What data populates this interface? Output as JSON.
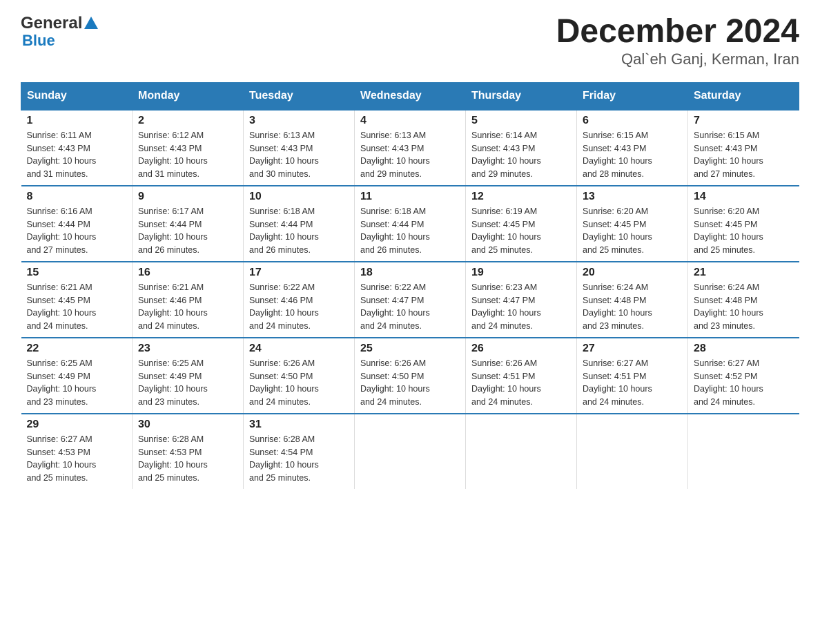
{
  "header": {
    "logo_general": "General",
    "logo_blue": "Blue",
    "title": "December 2024",
    "subtitle": "Qal`eh Ganj, Kerman, Iran"
  },
  "days_of_week": [
    "Sunday",
    "Monday",
    "Tuesday",
    "Wednesday",
    "Thursday",
    "Friday",
    "Saturday"
  ],
  "weeks": [
    [
      {
        "num": "1",
        "sunrise": "6:11 AM",
        "sunset": "4:43 PM",
        "daylight": "10 hours and 31 minutes."
      },
      {
        "num": "2",
        "sunrise": "6:12 AM",
        "sunset": "4:43 PM",
        "daylight": "10 hours and 31 minutes."
      },
      {
        "num": "3",
        "sunrise": "6:13 AM",
        "sunset": "4:43 PM",
        "daylight": "10 hours and 30 minutes."
      },
      {
        "num": "4",
        "sunrise": "6:13 AM",
        "sunset": "4:43 PM",
        "daylight": "10 hours and 29 minutes."
      },
      {
        "num": "5",
        "sunrise": "6:14 AM",
        "sunset": "4:43 PM",
        "daylight": "10 hours and 29 minutes."
      },
      {
        "num": "6",
        "sunrise": "6:15 AM",
        "sunset": "4:43 PM",
        "daylight": "10 hours and 28 minutes."
      },
      {
        "num": "7",
        "sunrise": "6:15 AM",
        "sunset": "4:43 PM",
        "daylight": "10 hours and 27 minutes."
      }
    ],
    [
      {
        "num": "8",
        "sunrise": "6:16 AM",
        "sunset": "4:44 PM",
        "daylight": "10 hours and 27 minutes."
      },
      {
        "num": "9",
        "sunrise": "6:17 AM",
        "sunset": "4:44 PM",
        "daylight": "10 hours and 26 minutes."
      },
      {
        "num": "10",
        "sunrise": "6:18 AM",
        "sunset": "4:44 PM",
        "daylight": "10 hours and 26 minutes."
      },
      {
        "num": "11",
        "sunrise": "6:18 AM",
        "sunset": "4:44 PM",
        "daylight": "10 hours and 26 minutes."
      },
      {
        "num": "12",
        "sunrise": "6:19 AM",
        "sunset": "4:45 PM",
        "daylight": "10 hours and 25 minutes."
      },
      {
        "num": "13",
        "sunrise": "6:20 AM",
        "sunset": "4:45 PM",
        "daylight": "10 hours and 25 minutes."
      },
      {
        "num": "14",
        "sunrise": "6:20 AM",
        "sunset": "4:45 PM",
        "daylight": "10 hours and 25 minutes."
      }
    ],
    [
      {
        "num": "15",
        "sunrise": "6:21 AM",
        "sunset": "4:45 PM",
        "daylight": "10 hours and 24 minutes."
      },
      {
        "num": "16",
        "sunrise": "6:21 AM",
        "sunset": "4:46 PM",
        "daylight": "10 hours and 24 minutes."
      },
      {
        "num": "17",
        "sunrise": "6:22 AM",
        "sunset": "4:46 PM",
        "daylight": "10 hours and 24 minutes."
      },
      {
        "num": "18",
        "sunrise": "6:22 AM",
        "sunset": "4:47 PM",
        "daylight": "10 hours and 24 minutes."
      },
      {
        "num": "19",
        "sunrise": "6:23 AM",
        "sunset": "4:47 PM",
        "daylight": "10 hours and 24 minutes."
      },
      {
        "num": "20",
        "sunrise": "6:24 AM",
        "sunset": "4:48 PM",
        "daylight": "10 hours and 23 minutes."
      },
      {
        "num": "21",
        "sunrise": "6:24 AM",
        "sunset": "4:48 PM",
        "daylight": "10 hours and 23 minutes."
      }
    ],
    [
      {
        "num": "22",
        "sunrise": "6:25 AM",
        "sunset": "4:49 PM",
        "daylight": "10 hours and 23 minutes."
      },
      {
        "num": "23",
        "sunrise": "6:25 AM",
        "sunset": "4:49 PM",
        "daylight": "10 hours and 23 minutes."
      },
      {
        "num": "24",
        "sunrise": "6:26 AM",
        "sunset": "4:50 PM",
        "daylight": "10 hours and 24 minutes."
      },
      {
        "num": "25",
        "sunrise": "6:26 AM",
        "sunset": "4:50 PM",
        "daylight": "10 hours and 24 minutes."
      },
      {
        "num": "26",
        "sunrise": "6:26 AM",
        "sunset": "4:51 PM",
        "daylight": "10 hours and 24 minutes."
      },
      {
        "num": "27",
        "sunrise": "6:27 AM",
        "sunset": "4:51 PM",
        "daylight": "10 hours and 24 minutes."
      },
      {
        "num": "28",
        "sunrise": "6:27 AM",
        "sunset": "4:52 PM",
        "daylight": "10 hours and 24 minutes."
      }
    ],
    [
      {
        "num": "29",
        "sunrise": "6:27 AM",
        "sunset": "4:53 PM",
        "daylight": "10 hours and 25 minutes."
      },
      {
        "num": "30",
        "sunrise": "6:28 AM",
        "sunset": "4:53 PM",
        "daylight": "10 hours and 25 minutes."
      },
      {
        "num": "31",
        "sunrise": "6:28 AM",
        "sunset": "4:54 PM",
        "daylight": "10 hours and 25 minutes."
      },
      null,
      null,
      null,
      null
    ]
  ],
  "labels": {
    "sunrise": "Sunrise:",
    "sunset": "Sunset:",
    "daylight": "Daylight:"
  }
}
